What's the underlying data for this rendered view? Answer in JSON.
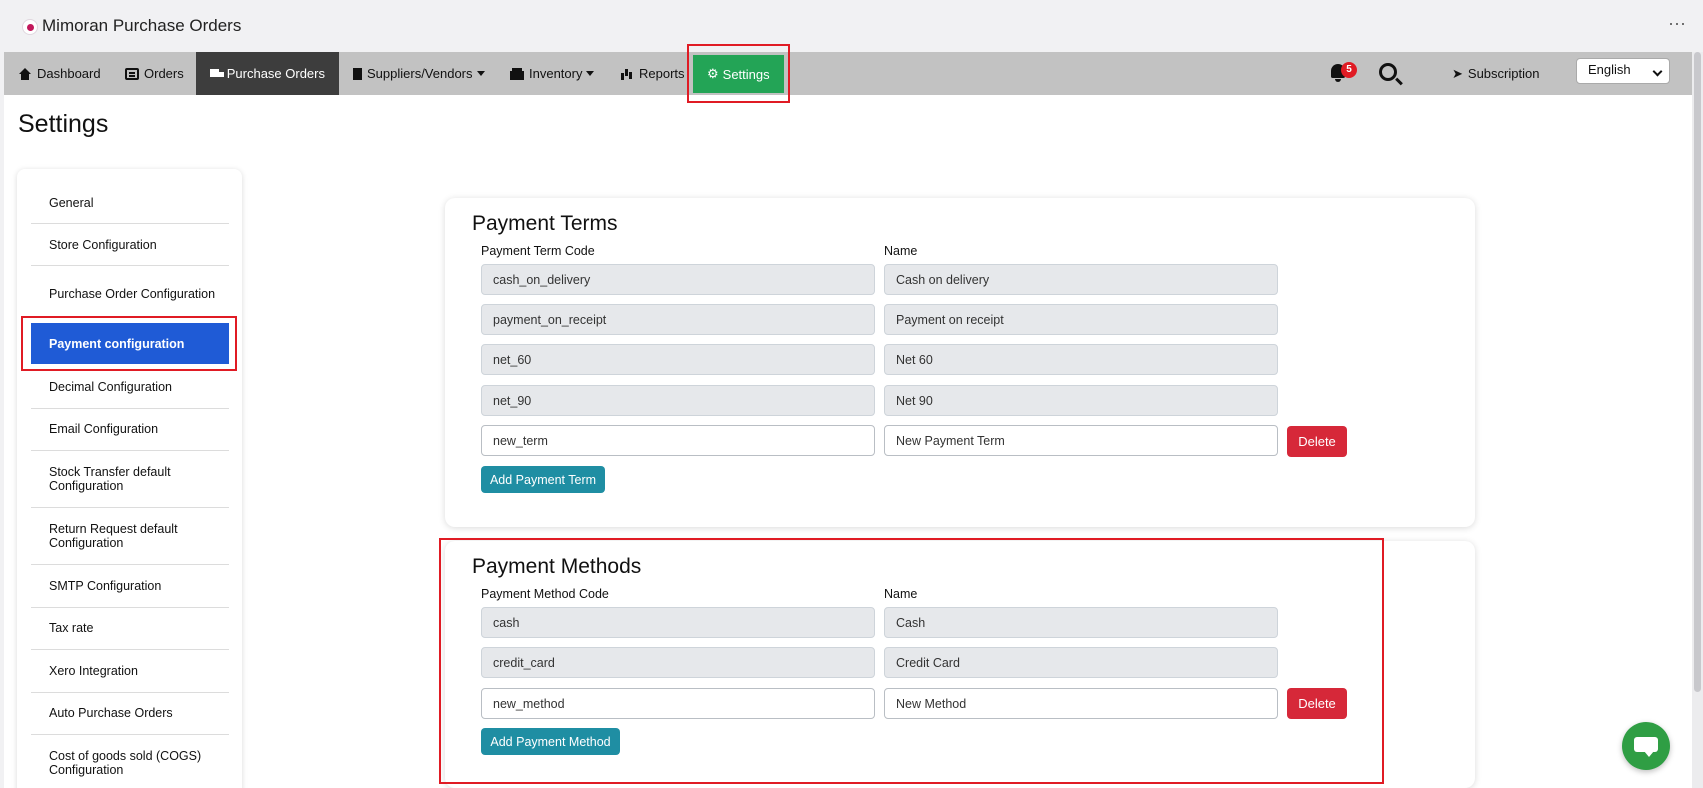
{
  "app": {
    "title": "Mimoran Purchase Orders",
    "more_icon": "ellipsis-icon"
  },
  "navbar": {
    "dashboard": "Dashboard",
    "orders": "Orders",
    "purchase_orders": "Purchase Orders",
    "suppliers": "Suppliers/Vendors",
    "inventory": "Inventory",
    "reports": "Reports",
    "settings": "Settings",
    "notification_count": "5",
    "subscription": "Subscription",
    "language": "English",
    "active_color": "#3d3d3d",
    "settings_color": "#23a456"
  },
  "page": {
    "title": "Settings"
  },
  "sidebar": {
    "items": [
      {
        "label": "General"
      },
      {
        "label": "Store Configuration"
      },
      {
        "label": "Purchase Order Configuration"
      },
      {
        "label": "Payment configuration"
      },
      {
        "label": "Decimal Configuration"
      },
      {
        "label": "Email Configuration"
      },
      {
        "label": "Stock Transfer default Configuration"
      },
      {
        "label": "Return Request default Configuration"
      },
      {
        "label": "SMTP Configuration"
      },
      {
        "label": "Tax rate"
      },
      {
        "label": "Xero Integration"
      },
      {
        "label": "Auto Purchase Orders"
      },
      {
        "label": "Cost of goods sold (COGS) Configuration"
      }
    ],
    "active_color": "#1f5bd6"
  },
  "payment_terms": {
    "title": "Payment Terms",
    "code_header": "Payment Term Code",
    "name_header": "Name",
    "rows": [
      {
        "code": "cash_on_delivery",
        "name": "Cash on delivery"
      },
      {
        "code": "payment_on_receipt",
        "name": "Payment on receipt"
      },
      {
        "code": "net_60",
        "name": "Net 60"
      },
      {
        "code": "net_90",
        "name": "Net 90"
      }
    ],
    "new_row": {
      "code": "new_term",
      "name": "New Payment Term",
      "delete_label": "Delete"
    },
    "add_label": "Add Payment Term"
  },
  "payment_methods": {
    "title": "Payment Methods",
    "code_header": "Payment Method Code",
    "name_header": "Name",
    "rows": [
      {
        "code": "cash",
        "name": "Cash"
      },
      {
        "code": "credit_card",
        "name": "Credit Card"
      }
    ],
    "new_row": {
      "code": "new_method",
      "name": "New Method",
      "delete_label": "Delete"
    },
    "add_label": "Add Payment Method"
  },
  "colors": {
    "highlight": "#e01b24",
    "danger": "#d62839",
    "info": "#1f8ea3"
  }
}
